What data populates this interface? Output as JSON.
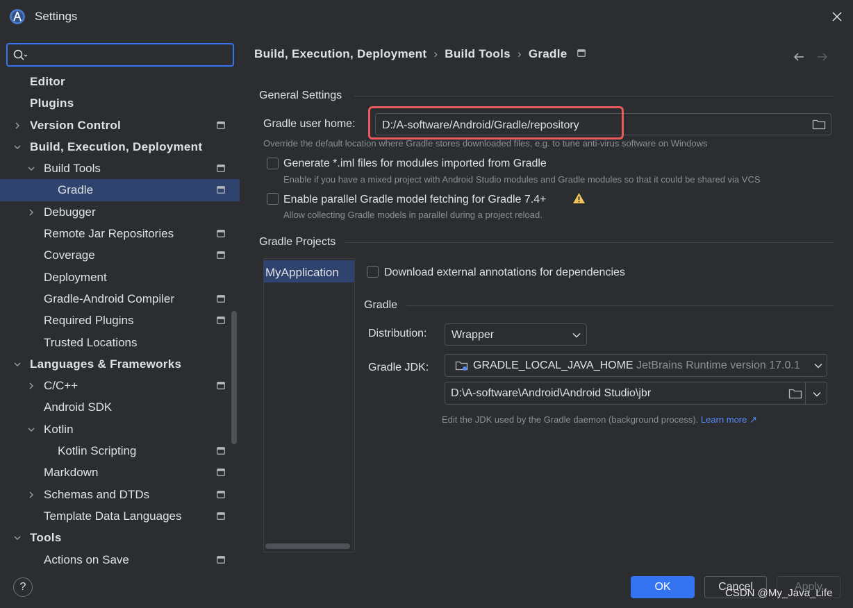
{
  "window": {
    "title": "Settings",
    "app_icon": "android-studio-icon",
    "close_icon": "close-icon"
  },
  "search": {
    "value": "",
    "placeholder": ""
  },
  "sidebar": {
    "items": [
      {
        "label": "Editor"
      },
      {
        "label": "Plugins"
      },
      {
        "label": "Version Control"
      },
      {
        "label": "Build, Execution, Deployment"
      },
      {
        "label": "Build Tools"
      },
      {
        "label": "Gradle"
      },
      {
        "label": "Debugger"
      },
      {
        "label": "Remote Jar Repositories"
      },
      {
        "label": "Coverage"
      },
      {
        "label": "Deployment"
      },
      {
        "label": "Gradle-Android Compiler"
      },
      {
        "label": "Required Plugins"
      },
      {
        "label": "Trusted Locations"
      },
      {
        "label": "Languages & Frameworks"
      },
      {
        "label": "C/C++"
      },
      {
        "label": "Android SDK"
      },
      {
        "label": "Kotlin"
      },
      {
        "label": "Kotlin Scripting"
      },
      {
        "label": "Markdown"
      },
      {
        "label": "Schemas and DTDs"
      },
      {
        "label": "Template Data Languages"
      },
      {
        "label": "Tools"
      },
      {
        "label": "Actions on Save"
      }
    ]
  },
  "breadcrumb": {
    "parts": [
      "Build, Execution, Deployment",
      "Build Tools",
      "Gradle"
    ],
    "separator": "›"
  },
  "general": {
    "title": "General Settings",
    "user_home_label": "Gradle user home:",
    "user_home_value": "D:/A-software/Android/Gradle/repository",
    "user_home_hint": "Override the default location where Gradle stores downloaded files, e.g. to tune anti-virus software on Windows",
    "iml_label": "Generate *.iml files for modules imported from Gradle",
    "iml_hint": "Enable if you have a mixed project with Android Studio modules and Gradle modules so that it could be shared via VCS",
    "parallel_label": "Enable parallel Gradle model fetching for Gradle 7.4+",
    "parallel_hint": "Allow collecting Gradle models in parallel during a project reload."
  },
  "projects": {
    "title": "Gradle Projects",
    "list": [
      "MyApplication"
    ],
    "annotations_label": "Download external annotations for dependencies",
    "gradle_title": "Gradle",
    "distribution_label": "Distribution:",
    "distribution_value": "Wrapper",
    "jdk_label": "Gradle JDK:",
    "jdk_name": "GRADLE_LOCAL_JAVA_HOME",
    "jdk_detail": "JetBrains Runtime version 17.0.1",
    "jdk_path": "D:\\A-software\\Android\\Android Studio\\jbr",
    "jdk_hint": "Edit the JDK used by the Gradle daemon (background process).",
    "learn_more": "Learn more ↗"
  },
  "footer": {
    "help": "?",
    "ok": "OK",
    "cancel": "Cancel",
    "apply": "Apply",
    "watermark": "CSDN @My_Java_Life"
  },
  "colors": {
    "accent": "#3574f0",
    "selection": "#2e436e",
    "highlight_box": "#e95a5a",
    "warning": "#f2c55c",
    "background": "#2b2d30"
  }
}
